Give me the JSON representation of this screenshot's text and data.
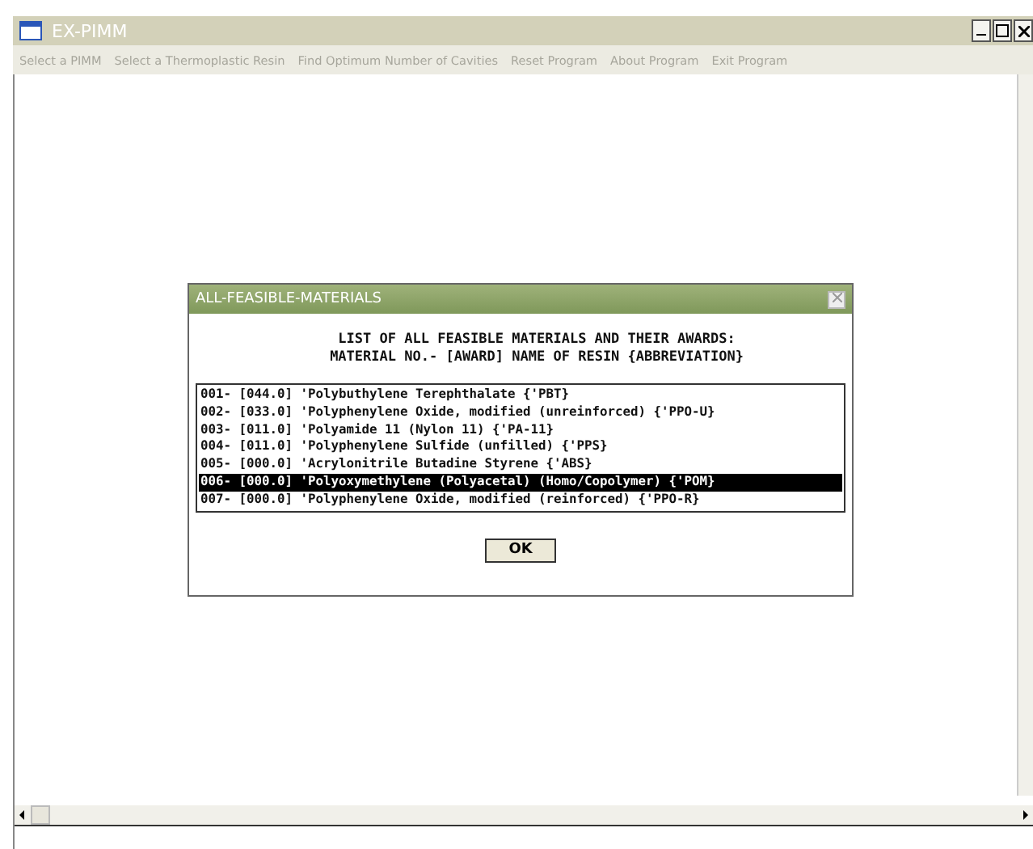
{
  "window": {
    "title": "EX-PIMM"
  },
  "menu": [
    "Select a PIMM",
    "Select a Thermoplastic Resin",
    "Find Optimum Number of Cavities",
    "Reset Program",
    "About Program",
    "Exit Program"
  ],
  "dialog": {
    "title": "ALL-FEASIBLE-MATERIALS",
    "heading": [
      "LIST OF ALL FEASIBLE MATERIALS AND THEIR AWARDS:",
      "MATERIAL NO.- [AWARD] NAME OF RESIN {ABBREVIATION}"
    ],
    "materials": [
      {
        "text": "001- [044.0] 'Polybuthylene Terephthalate {'PBT}",
        "selected": false
      },
      {
        "text": "002- [033.0] 'Polyphenylene Oxide, modified (unreinforced) {'PPO-U}",
        "selected": false
      },
      {
        "text": "003- [011.0] 'Polyamide 11 (Nylon 11) {'PA-11}",
        "selected": false
      },
      {
        "text": "004- [011.0] 'Polyphenylene Sulfide (unfilled) {'PPS}",
        "selected": false
      },
      {
        "text": "005- [000.0] 'Acrylonitrile Butadine Styrene {'ABS}",
        "selected": false
      },
      {
        "text": "006- [000.0] 'Polyoxymethylene (Polyacetal) (Homo/Copolymer) {'POM}",
        "selected": true
      },
      {
        "text": "007- [000.0] 'Polyphenylene Oxide, modified (reinforced) {'PPO-R}",
        "selected": false
      }
    ],
    "button": "OK"
  }
}
